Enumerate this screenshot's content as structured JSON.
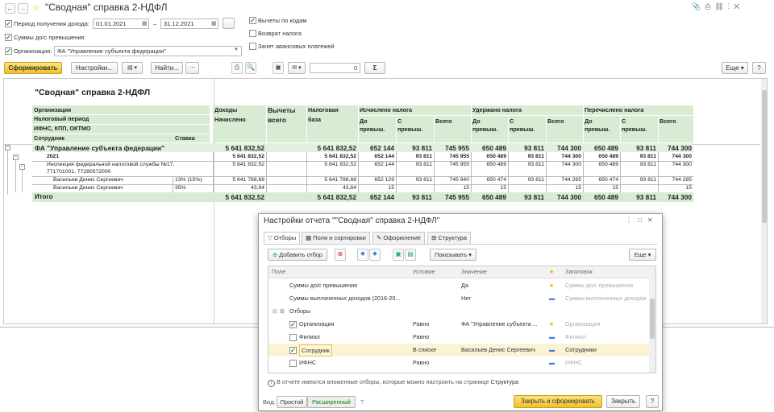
{
  "title": "\"Сводная\" справка 2-НДФЛ",
  "params": {
    "period_label": "Период получения дохода:",
    "date_from": "01.01.2021",
    "dash": "–",
    "date_to": "31.12.2021",
    "dots": "...",
    "sums_label": "Суммы до/с превышения",
    "org_label": "Организация:",
    "org_value": "ФА \"Управление субъекта федерации\"",
    "deductions_label": "Вычеты по кодам",
    "refund_label": "Возврат налога",
    "advance_label": "Зачет авансовых платежей"
  },
  "toolbar": {
    "generate": "Сформировать",
    "settings": "Настройки...",
    "find": "Найти...",
    "counter": "0",
    "sigma": "Σ",
    "more": "Еще",
    "help": "?"
  },
  "report": {
    "heading": "\"Сводная\" справка 2-НДФЛ",
    "hdr": {
      "org": "Организация",
      "period": "Налоговый период",
      "ifns": "ИФНС, КПП, ОКТМО",
      "employee": "Сотрудник",
      "rate": "Ставка",
      "income": "Доходы",
      "accrued": "Начислено",
      "deductions1": "Вычеты",
      "deductions2": "всего",
      "base1": "Налоговая",
      "base2": "база",
      "calc": "Исчислено налога",
      "withheld": "Удержано налога",
      "transferred": "Перечислено налога",
      "upto1": "До",
      "upto2": "превыш.",
      "from1": "С",
      "from2": "превыш.",
      "total": "Всего"
    },
    "rows": [
      {
        "name": "ФА \"Управление субъекта федерации\"",
        "rate": "",
        "income": "5 641 832,52",
        "ded": "",
        "base": "5 641 832,52",
        "c1": "652 144",
        "c2": "93 811",
        "c3": "745 955",
        "w1": "650 489",
        "w2": "93 811",
        "w3": "744 300",
        "p1": "650 489",
        "p2": "93 811",
        "p3": "744 300"
      },
      {
        "name": "2021",
        "rate": "",
        "income": "5 641 832,52",
        "ded": "",
        "base": "5 641 832,52",
        "c1": "652 144",
        "c2": "93 811",
        "c3": "745 955",
        "w1": "650 489",
        "w2": "93 811",
        "w3": "744 300",
        "p1": "650 489",
        "p2": "93 811",
        "p3": "744 300"
      },
      {
        "name": "Инспекция федеральной налоговой службы №17,",
        "name2": "771701001, 77280572000",
        "rate": "",
        "income": "5 641 832,52",
        "ded": "",
        "base": "5 641 832,52",
        "c1": "652 144",
        "c2": "93 811",
        "c3": "745 955",
        "w1": "650 489",
        "w2": "93 811",
        "w3": "744 300",
        "p1": "650 489",
        "p2": "93 811",
        "p3": "744 300"
      },
      {
        "name": "Васильев Денис Сергеевич",
        "rate": "13% (15%)",
        "income": "5 641 788,68",
        "ded": "",
        "base": "5 641 788,68",
        "c1": "652 129",
        "c2": "93 811",
        "c3": "745 940",
        "w1": "650 474",
        "w2": "93 811",
        "w3": "744 285",
        "p1": "650 474",
        "p2": "93 811",
        "p3": "744 285"
      },
      {
        "name": "Васильев Денис Сергеевич",
        "rate": "35%",
        "income": "43,84",
        "ded": "",
        "base": "43,84",
        "c1": "15",
        "c2": "",
        "c3": "15",
        "w1": "15",
        "w2": "",
        "w3": "15",
        "p1": "15",
        "p2": "",
        "p3": "15"
      }
    ],
    "total": {
      "name": "Итого",
      "income": "5 641 832,52",
      "base": "5 641 832,52",
      "c1": "652 144",
      "c2": "93 811",
      "c3": "745 955",
      "w1": "650 489",
      "w2": "93 811",
      "w3": "744 300",
      "p1": "650 489",
      "p2": "93 811",
      "p3": "744 300"
    }
  },
  "dialog": {
    "title": "Настройки отчета \"\"Сводная\" справка 2-НДФЛ\"",
    "tabs": [
      "Отборы",
      "Поля и сортировки",
      "Оформление",
      "Структура"
    ],
    "add_filter": "Добавить отбор",
    "show": "Показывать",
    "more": "Еще",
    "cols": {
      "field": "Поле",
      "cond": "Условие",
      "value": "Значение",
      "header": "Заголовок"
    },
    "rows": [
      {
        "field": "Суммы до/с превышения",
        "cond": "",
        "value": "Да",
        "header": "Суммы до/с превышения"
      },
      {
        "field": "Суммы выплаченных доходов (2016-20...",
        "cond": "",
        "value": "Нет",
        "header": "Суммы выплаченных доходов"
      },
      {
        "field": "Отборы",
        "cond": "",
        "value": "",
        "header": ""
      },
      {
        "field": "Организация",
        "cond": "Равно",
        "value": "ФА \"Управление субъекта ...",
        "header": "Организация"
      },
      {
        "field": "Филиал",
        "cond": "Равно",
        "value": "",
        "header": "Филиал"
      },
      {
        "field": "Сотрудник",
        "cond": "В списке",
        "value": "Васильев Денис Сергеевич",
        "header": "Сотрудники"
      },
      {
        "field": "ИФНС",
        "cond": "Равно",
        "value": "",
        "header": "ИФНС"
      }
    ],
    "info_pre": "В отчете имеются вложенные отборы, которые можно настроить на странице ",
    "info_link": "Структура",
    "view_label": "Вид:",
    "view_simple": "Простой",
    "view_extended": "Расширенный",
    "help": "?",
    "close_generate": "Закрыть и сформировать",
    "close": "Закрыть",
    "help2": "?"
  },
  "colors": {
    "accent": "#f6c631",
    "green_header": "#d8ebd3",
    "selected_row": "#fbf3d4"
  }
}
